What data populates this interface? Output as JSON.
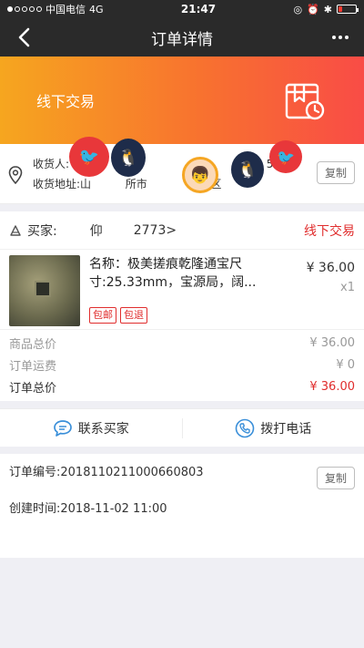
{
  "status_bar": {
    "carrier": "中国电信",
    "network": "4G",
    "time": "21:47"
  },
  "nav": {
    "title": "订单详情",
    "back_icon": "chevron-left-icon",
    "more_icon": "more-dots-icon"
  },
  "banner": {
    "title": "线下交易",
    "icon": "gift-clock-icon"
  },
  "address": {
    "receiver": "收货人:",
    "receiver_phone": "39 57",
    "address_label": "收货地址:山",
    "address_middle": "所市",
    "address_tail": "区",
    "copy_label": "复制"
  },
  "buyer": {
    "label": "买家:",
    "name_partial": "仰",
    "id_tail": "2773>",
    "status": "线下交易"
  },
  "product": {
    "name": "名称：极美搓痕乾隆通宝尺寸:25.33mm，宝源局，阔...",
    "price": "¥ 36.00",
    "quantity": "x1",
    "tags": [
      "包邮",
      "包退"
    ]
  },
  "summary": {
    "goods_total_label": "商品总价",
    "goods_total": "¥ 36.00",
    "shipping_label": "订单运费",
    "shipping": "¥ 0",
    "order_total_label": "订单总价",
    "order_total": "¥ 36.00"
  },
  "actions": {
    "contact_buyer": "联系买家",
    "call_phone": "拨打电话"
  },
  "order_info": {
    "order_no": "订单编号:2018110211000660803",
    "created": "创建时间:2018-11-02 11:00",
    "copy_label": "复制"
  },
  "colors": {
    "accent_red": "#e02d2d",
    "banner_start": "#f6a61f",
    "banner_end": "#f94c46",
    "nav_bg": "#2a2a2a"
  }
}
